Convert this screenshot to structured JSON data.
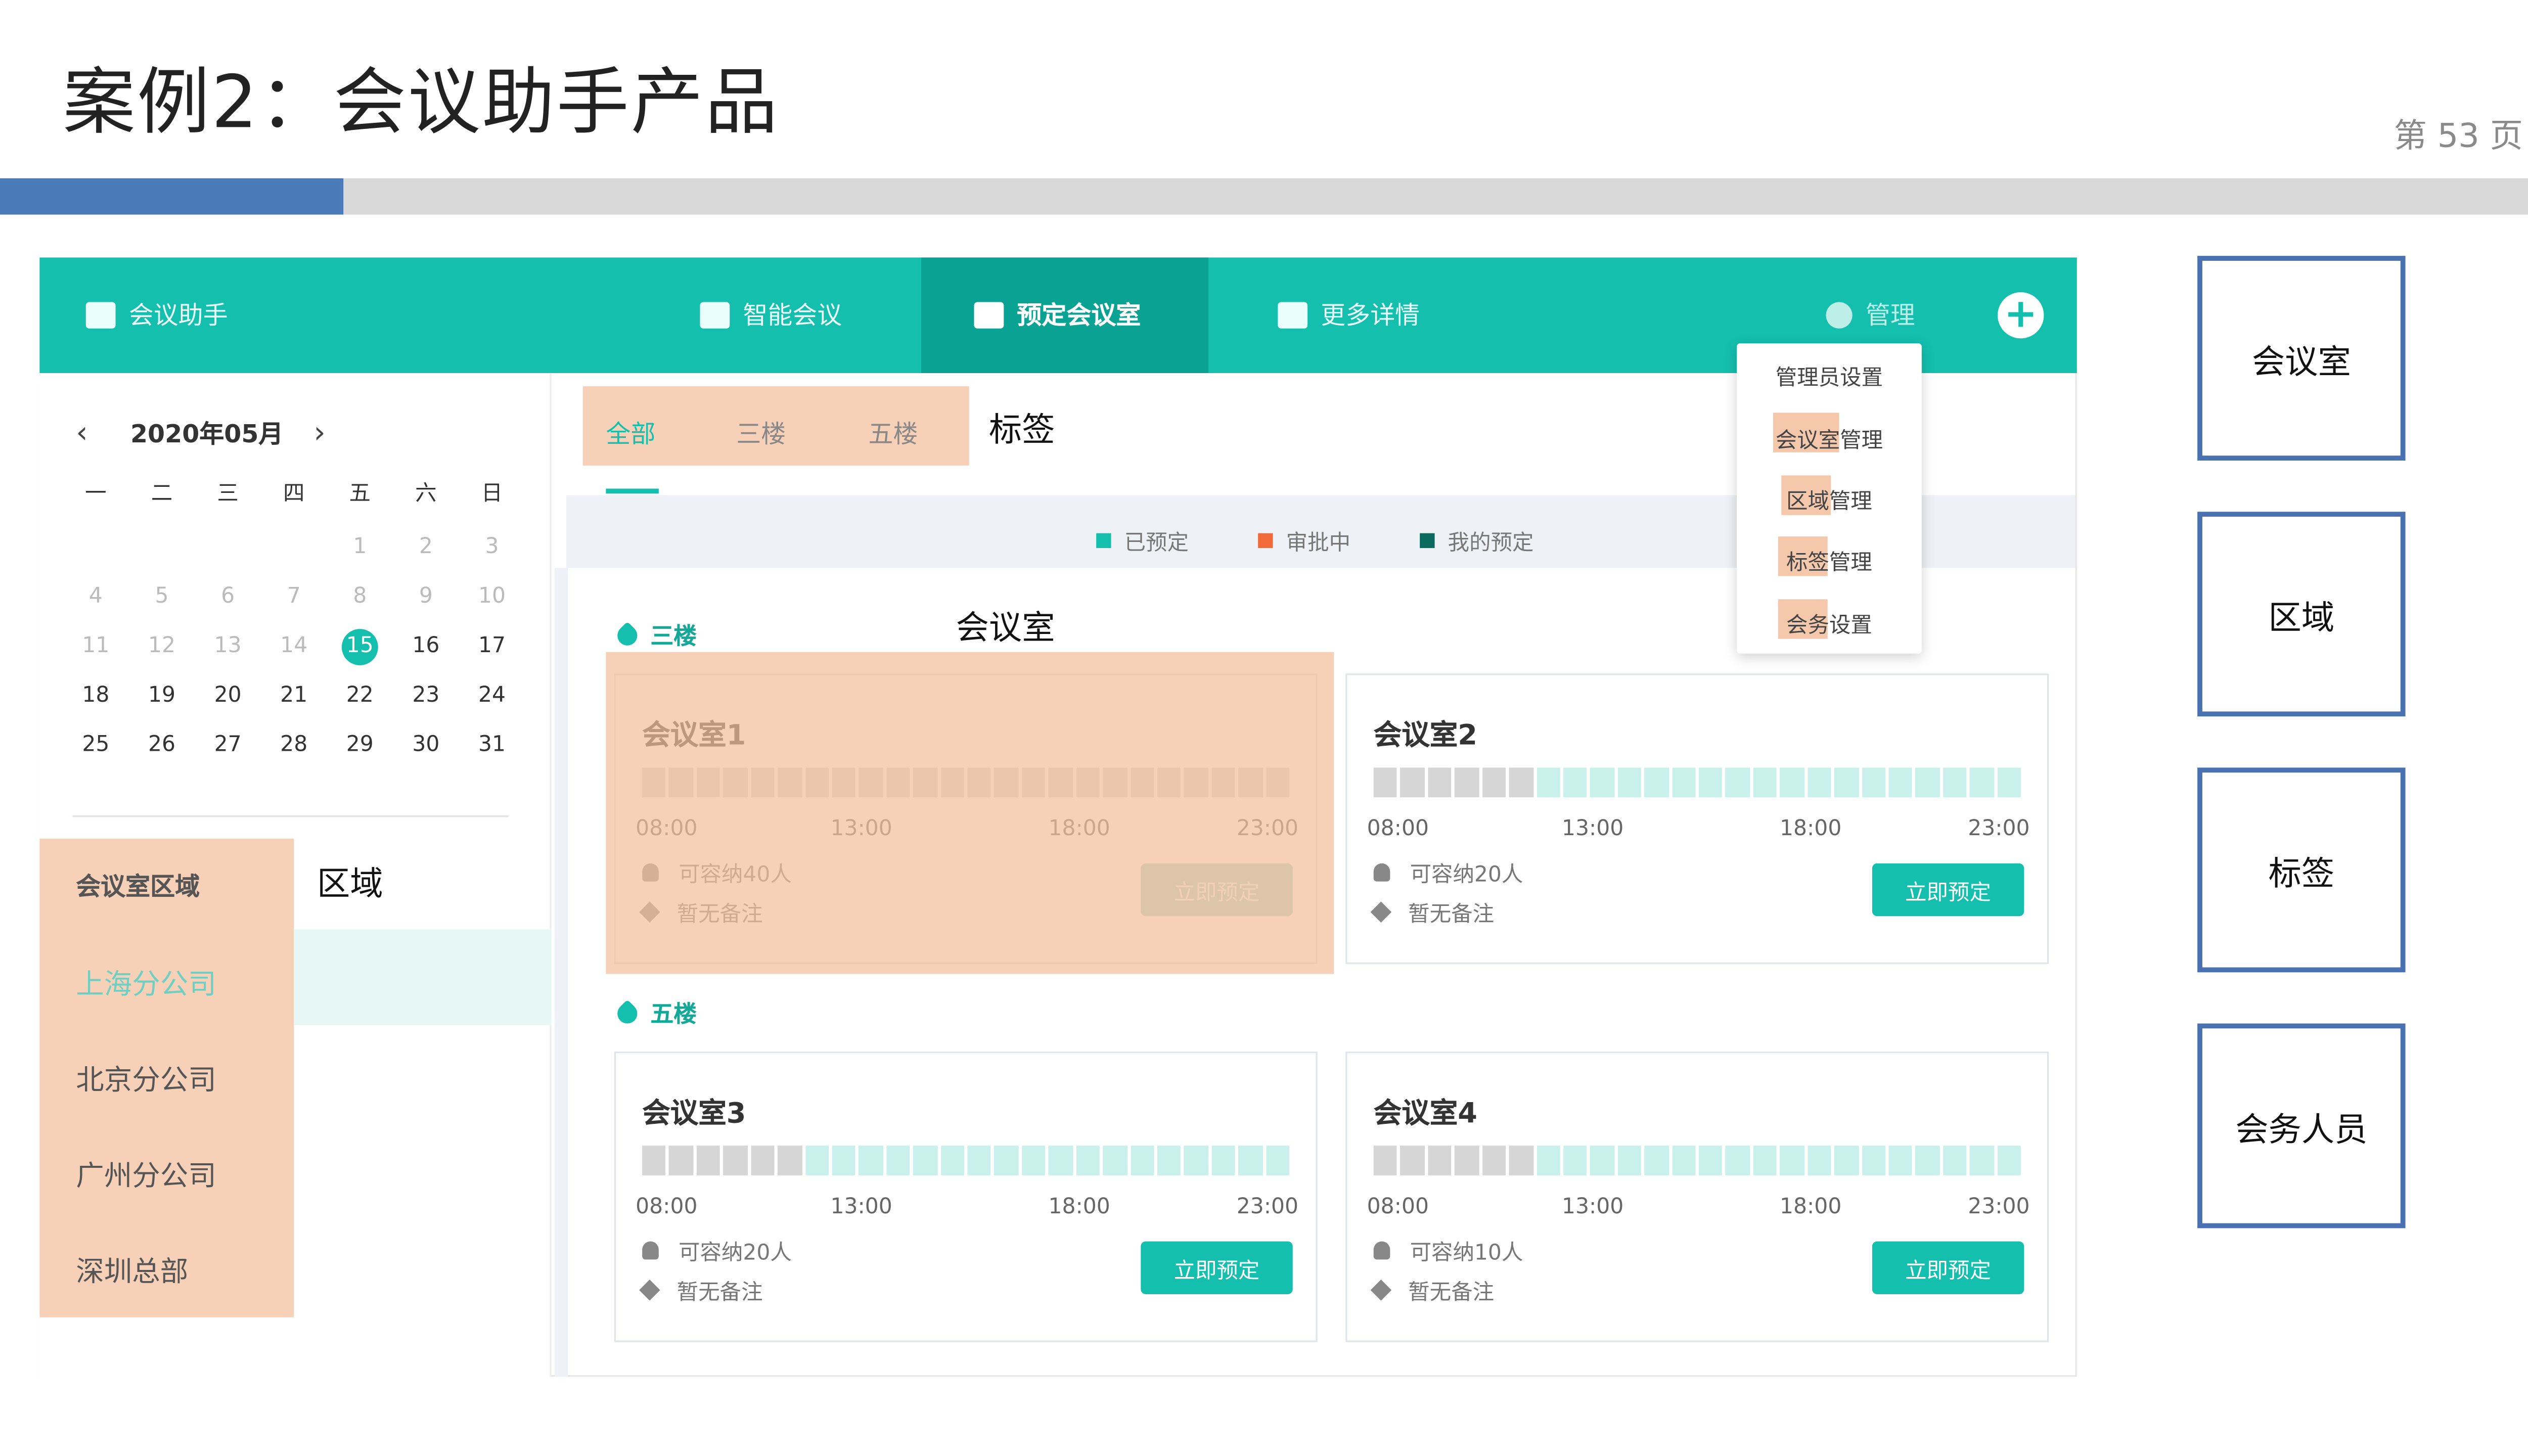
{
  "slide": {
    "title": "案例2：会议助手产品",
    "page": "第 53 页"
  },
  "colors": {
    "accent": "#14bfae",
    "accent_dark": "#0aa393",
    "highlight": "#f4be9c",
    "box_border": "#4a72b0",
    "progress_blue": "#4a7ab8"
  },
  "app": {
    "logo": "会议助手",
    "nav": [
      "智能会议",
      "预定会议室",
      "更多详情"
    ],
    "active_nav": "预定会议室",
    "manage": "管理",
    "add_icon": "plus-circle-icon",
    "dropdown": [
      "管理员设置",
      "会议室管理",
      "区域管理",
      "标签管理",
      "会务设置"
    ]
  },
  "calendar": {
    "month": "2020年05月",
    "weekdays": [
      "一",
      "二",
      "三",
      "四",
      "五",
      "六",
      "日"
    ],
    "today": "15"
  },
  "regions": {
    "header": "会议室区域",
    "items": [
      "上海分公司",
      "北京分公司",
      "广州分公司",
      "深圳总部"
    ],
    "selected": "上海分公司"
  },
  "tabs": [
    "全部",
    "三楼",
    "五楼"
  ],
  "legend": [
    "已预定",
    "审批中",
    "我的预定"
  ],
  "floors": [
    "三楼",
    "五楼"
  ],
  "rooms": [
    {
      "name": "会议室1",
      "capacity": "可容纳40人",
      "note": "暂无备注",
      "book": "立即预定",
      "busy_slots": 24,
      "disabled": true
    },
    {
      "name": "会议室2",
      "capacity": "可容纳20人",
      "note": "暂无备注",
      "book": "立即预定",
      "busy_slots": 6,
      "disabled": false
    },
    {
      "name": "会议室3",
      "capacity": "可容纳20人",
      "note": "暂无备注",
      "book": "立即预定",
      "busy_slots": 6,
      "disabled": false
    },
    {
      "name": "会议室4",
      "capacity": "可容纳10人",
      "note": "暂无备注",
      "book": "立即预定",
      "busy_slots": 6,
      "disabled": false
    }
  ],
  "times": [
    "08:00",
    "13:00",
    "18:00",
    "23:00"
  ],
  "annotations": {
    "tag": "标签",
    "room": "会议室",
    "region": "区域"
  },
  "side_boxes": [
    "会议室",
    "区域",
    "标签",
    "会务人员"
  ]
}
